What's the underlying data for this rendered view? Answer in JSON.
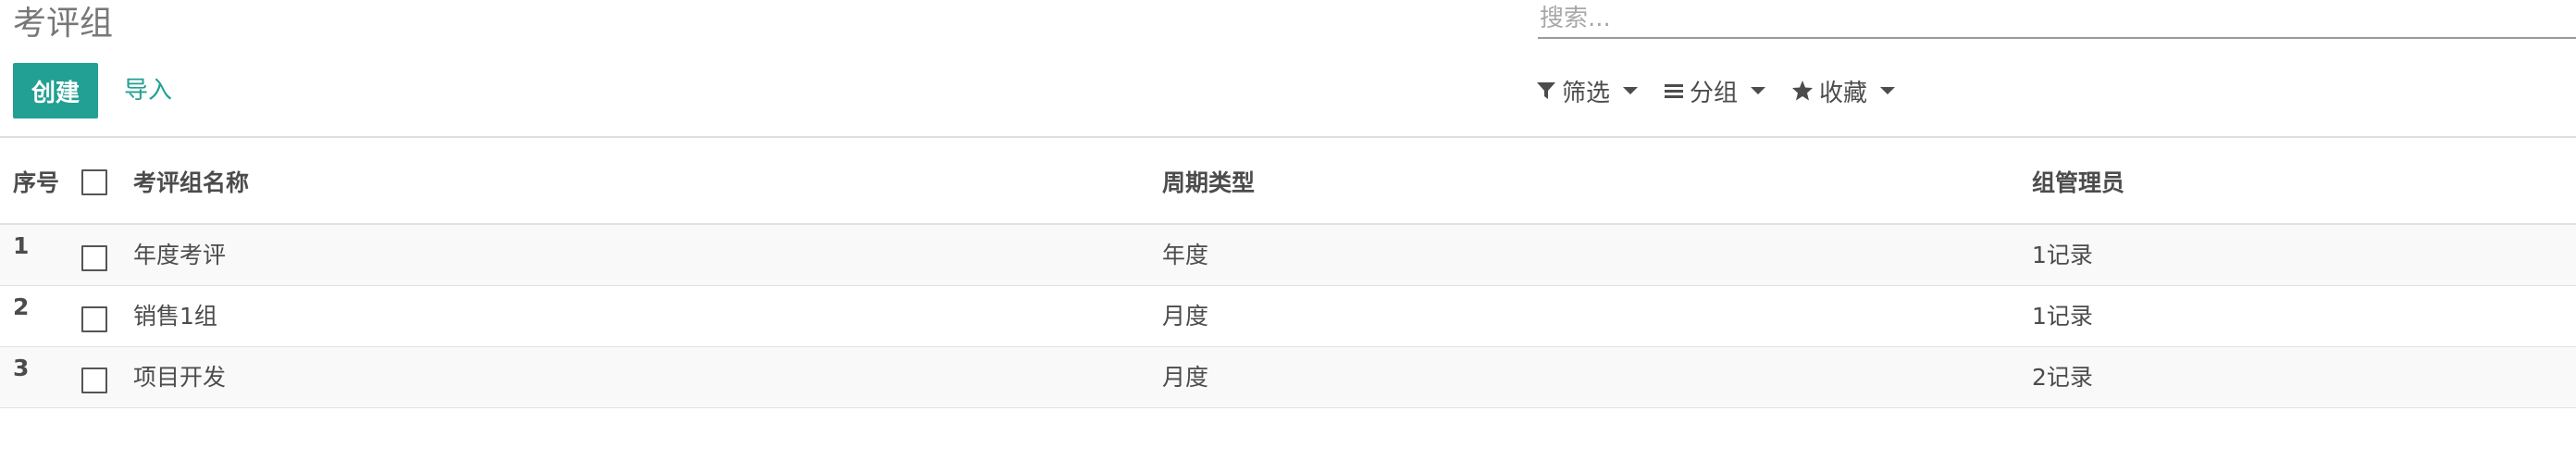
{
  "breadcrumb": {
    "title": "考评组"
  },
  "search": {
    "placeholder": "搜索..."
  },
  "toolbar": {
    "create_label": "创建",
    "import_label": "导入"
  },
  "filters": [
    {
      "label": "筛选",
      "icon": "filter-icon"
    },
    {
      "label": "分组",
      "icon": "bars-icon"
    },
    {
      "label": "收藏",
      "icon": "star-icon"
    }
  ],
  "colors": {
    "primary": "#21a093",
    "text": "#4c4c4c",
    "muted": "#777777",
    "stripe": "#f9f9f9"
  },
  "table": {
    "columns": [
      "序号",
      "考评组名称",
      "周期类型",
      "组管理员"
    ],
    "rows": [
      {
        "seq": "1",
        "name": "年度考评",
        "cycle": "年度",
        "manager": "1记录"
      },
      {
        "seq": "2",
        "name": "销售1组",
        "cycle": "月度",
        "manager": "1记录"
      },
      {
        "seq": "3",
        "name": "项目开发",
        "cycle": "月度",
        "manager": "2记录"
      }
    ]
  }
}
